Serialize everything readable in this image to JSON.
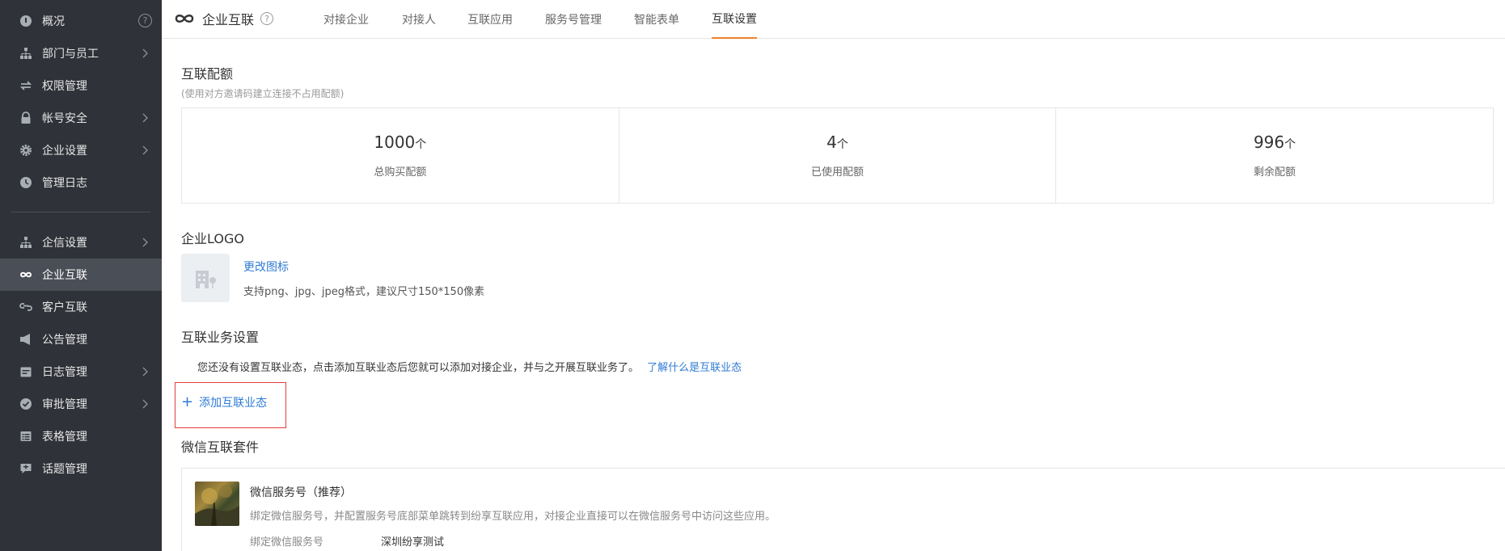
{
  "sidebar": {
    "items": [
      {
        "label": "概况",
        "icon": "dashboard-icon"
      },
      {
        "label": "部门与员工",
        "icon": "org-tree-icon"
      },
      {
        "label": "权限管理",
        "icon": "sync-icon"
      },
      {
        "label": "帐号安全",
        "icon": "lock-icon"
      },
      {
        "label": "企业设置",
        "icon": "gear-icon"
      },
      {
        "label": "管理日志",
        "icon": "clock-icon"
      },
      {
        "label": "企信设置",
        "icon": "org-tree-icon"
      },
      {
        "label": "企业互联",
        "icon": "infinity-icon"
      },
      {
        "label": "客户互联",
        "icon": "link-icon"
      },
      {
        "label": "公告管理",
        "icon": "megaphone-icon"
      },
      {
        "label": "日志管理",
        "icon": "calendar-icon"
      },
      {
        "label": "审批管理",
        "icon": "check-badge-icon"
      },
      {
        "label": "表格管理",
        "icon": "table-icon"
      },
      {
        "label": "话题管理",
        "icon": "chat-icon"
      }
    ],
    "help_glyph": "?"
  },
  "header": {
    "title": "企业互联",
    "help_glyph": "?",
    "tabs": [
      {
        "label": "对接企业"
      },
      {
        "label": "对接人"
      },
      {
        "label": "互联应用"
      },
      {
        "label": "服务号管理"
      },
      {
        "label": "智能表单"
      },
      {
        "label": "互联设置"
      }
    ],
    "active_tab": "互联设置",
    "accent_color": "#f0822d"
  },
  "quota": {
    "title": "互联配额",
    "hint": "(使用对方邀请码建立连接不占用配额)",
    "cells": [
      {
        "value": "1000",
        "unit": "个",
        "label": "总购买配额"
      },
      {
        "value": "4",
        "unit": "个",
        "label": "已使用配额"
      },
      {
        "value": "996",
        "unit": "个",
        "label": "剩余配额"
      }
    ]
  },
  "logo": {
    "title": "企业LOGO",
    "change_link": "更改图标",
    "hint": "支持png、jpg、jpeg格式，建议尺寸150*150像素"
  },
  "business": {
    "title": "互联业务设置",
    "notice": "您还没有设置互联业态，点击添加互联业态后您就可以添加对接企业，并与之开展互联业务了。",
    "learn_link": "了解什么是互联业态",
    "add_label": "添加互联业态",
    "add_glyph": "+"
  },
  "wechat": {
    "title": "微信互联套件",
    "item_title": "微信服务号（推荐）",
    "item_desc": "绑定微信服务号，并配置服务号底部菜单跳转到纷享互联应用，对接企业直接可以在微信服务号中访问这些应用。",
    "bind_label": "绑定微信服务号",
    "bind_value": "深圳纷享测试"
  }
}
